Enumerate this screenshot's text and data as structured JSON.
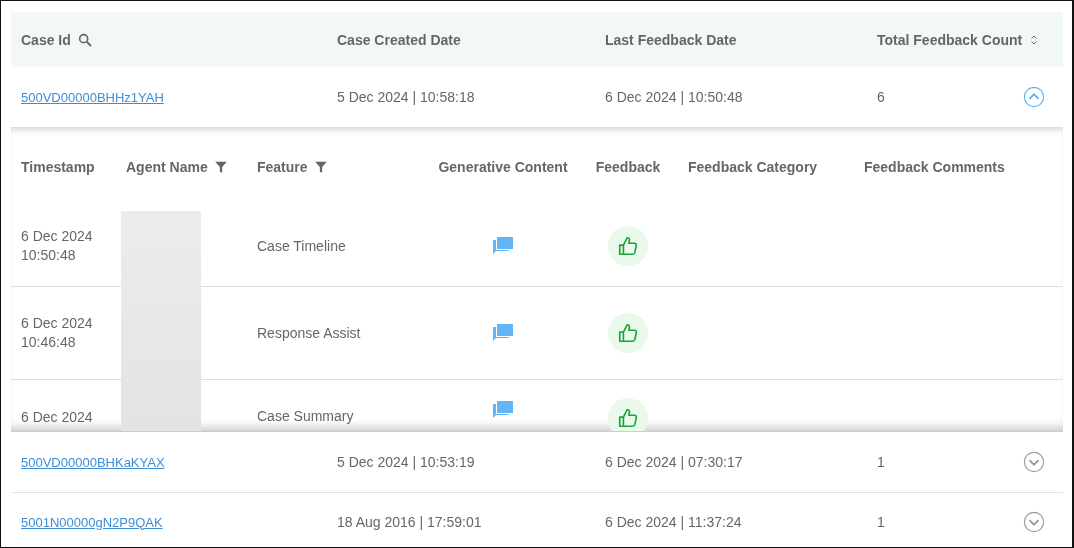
{
  "table": {
    "columns": [
      {
        "label": "Case Id",
        "kind": "search"
      },
      {
        "label": "Case Created Date"
      },
      {
        "label": "Last Feedback Date"
      },
      {
        "label": "Total Feedback Count",
        "kind": "sort"
      }
    ],
    "rows": [
      {
        "case_id": "500VD00000BHHz1YAH",
        "created": "5 Dec 2024 | 10:58:18",
        "last_feedback": "6 Dec 2024 | 10:50:48",
        "count": "6",
        "expanded": true,
        "details": {
          "columns": [
            {
              "label": "Timestamp"
            },
            {
              "label": "Agent Name",
              "kind": "filter"
            },
            {
              "label": "Feature",
              "kind": "filter"
            },
            {
              "label": "Generative Content"
            },
            {
              "label": "Feedback"
            },
            {
              "label": "Feedback Category"
            },
            {
              "label": "Feedback Comments"
            }
          ],
          "rows": [
            {
              "timestamp": "6 Dec 2024 10:50:48",
              "feature": "Case Timeline",
              "kind": "positive"
            },
            {
              "timestamp": "6 Dec 2024 10:46:48",
              "feature": "Response Assist",
              "kind": "positive"
            },
            {
              "timestamp": "6 Dec 2024",
              "feature": "Case Summary",
              "kind": "positive"
            }
          ]
        }
      },
      {
        "case_id": "500VD00000BHKaKYAX",
        "created": "5 Dec 2024 | 10:53:19",
        "last_feedback": "6 Dec 2024 | 07:30:17",
        "count": "1",
        "expanded": false
      },
      {
        "case_id": "5001N00000gN2P9QAK",
        "created": "18 Aug 2016 | 17:59:01",
        "last_feedback": "6 Dec 2024 | 11:37:24",
        "count": "1",
        "expanded": false
      }
    ]
  }
}
